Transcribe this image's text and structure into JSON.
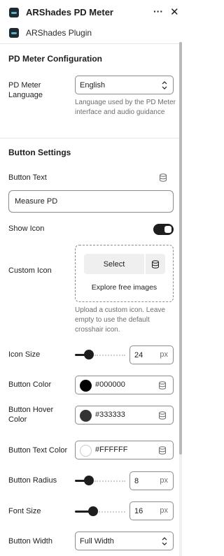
{
  "header": {
    "title": "ARShades PD Meter",
    "more_glyph": "···",
    "close_glyph": "✕"
  },
  "plugin": {
    "name": "ARShades Plugin"
  },
  "pd_meter_section": {
    "title": "PD Meter Configuration",
    "language_label": "PD Meter Language",
    "language_value": "English",
    "language_help": "Language used by the PD Meter interface and audio guidance"
  },
  "button_section": {
    "title": "Button Settings",
    "button_text_label": "Button Text",
    "button_text_value": "Measure PD",
    "show_icon_label": "Show Icon",
    "show_icon_on": true,
    "custom_icon_label": "Custom Icon",
    "select_label": "Select",
    "explore_label": "Explore free images",
    "custom_icon_help": "Upload a custom icon. Leave empty to use the default crosshair icon.",
    "icon_size_label": "Icon Size",
    "icon_size_value": "24",
    "icon_size_fraction": 0.28,
    "button_color_label": "Button Color",
    "button_color_value": "#000000",
    "button_hover_label": "Button Hover Color",
    "button_hover_value": "#333333",
    "button_text_color_label": "Button Text Color",
    "button_text_color_value": "#FFFFFF",
    "button_radius_label": "Button Radius",
    "button_radius_value": "8",
    "button_radius_fraction": 0.28,
    "font_size_label": "Font Size",
    "font_size_value": "16",
    "font_size_fraction": 0.36,
    "button_width_label": "Button Width",
    "button_width_value": "Full Width",
    "unit": "px"
  },
  "colors": {
    "accent": "#1e1e1e",
    "border": "#8c8c8c",
    "help_text": "#6e6e6e",
    "app_icon_bg": "#1d2a33"
  }
}
